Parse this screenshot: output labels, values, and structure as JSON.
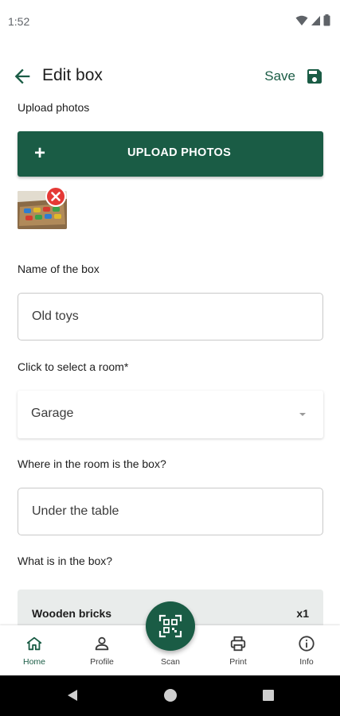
{
  "status_bar": {
    "time": "1:52"
  },
  "app_bar": {
    "title": "Edit box",
    "save_label": "Save"
  },
  "upload": {
    "section_label": "Upload photos",
    "button_label": "UPLOAD PHOTOS",
    "plus_glyph": "+"
  },
  "name_field": {
    "label": "Name of the box",
    "value": "Old toys"
  },
  "room_field": {
    "label": "Click to select a room*",
    "value": "Garage"
  },
  "location_field": {
    "label": "Where in the room is the box?",
    "value": "Under the table"
  },
  "contents": {
    "label": "What is in the box?",
    "items": [
      {
        "name": "Wooden bricks",
        "quantity": "x1"
      }
    ]
  },
  "bottom_nav": {
    "items": [
      {
        "label": "Home",
        "icon": "home-icon",
        "active": true
      },
      {
        "label": "Profile",
        "icon": "person-icon"
      },
      {
        "label": "Scan",
        "icon": "qr-scan-icon"
      },
      {
        "label": "Print",
        "icon": "printer-icon"
      },
      {
        "label": "Info",
        "icon": "info-icon"
      }
    ]
  },
  "colors": {
    "primary": "#1a5c45",
    "remove": "#e53935",
    "item_bg": "#e9eceb"
  }
}
